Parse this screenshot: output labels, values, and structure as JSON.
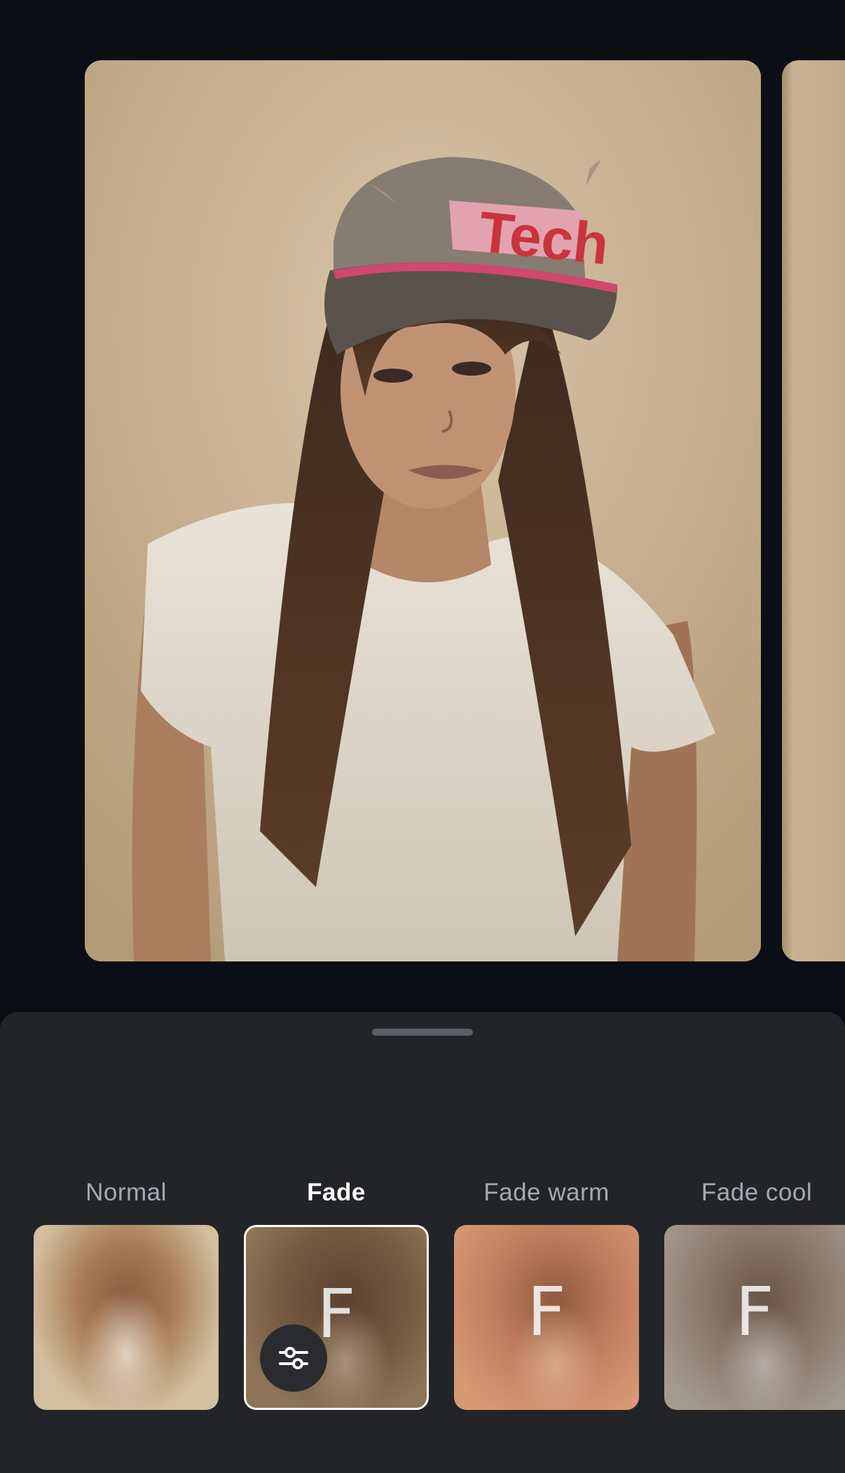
{
  "filters": [
    {
      "label": "Normal",
      "letter": "",
      "selected": false
    },
    {
      "label": "Fade",
      "letter": "F",
      "selected": true
    },
    {
      "label": "Fade warm",
      "letter": "F",
      "selected": false
    },
    {
      "label": "Fade cool",
      "letter": "F",
      "selected": false
    }
  ],
  "icons": {
    "adjust": "sliders-icon",
    "grabber": "drag-handle"
  },
  "colors": {
    "background": "#0b0e15",
    "sheet": "#232427",
    "selected_label": "#ffffff",
    "label": "#a6aab3"
  }
}
